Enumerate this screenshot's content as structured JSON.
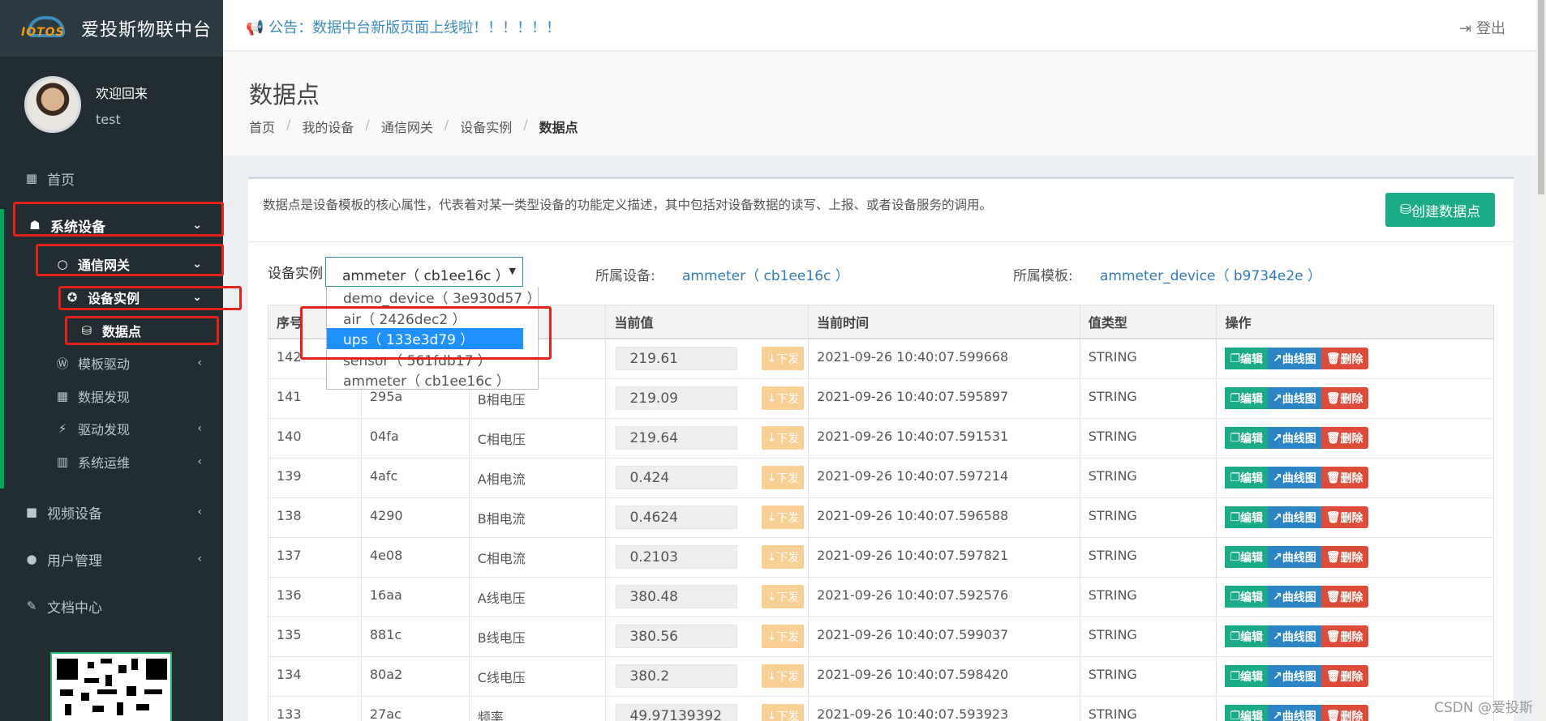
{
  "app": {
    "logo_text": "IOTOS",
    "title": "爱投斯物联中台"
  },
  "user": {
    "welcome": "欢迎回来",
    "name": "test"
  },
  "sidebar": {
    "items": [
      {
        "label": "首页",
        "icon": "dashboard-icon"
      },
      {
        "label": "系统设备",
        "icon": "sitemap-icon"
      },
      {
        "label": "通信网关",
        "icon": "circle-icon"
      },
      {
        "label": "设备实例",
        "icon": "rebel-icon"
      },
      {
        "label": "数据点",
        "icon": "database-icon"
      },
      {
        "label": "模板驱动",
        "icon": "wordpress-icon"
      },
      {
        "label": "数据发现",
        "icon": "table-icon"
      },
      {
        "label": "驱动发现",
        "icon": "plug-icon"
      },
      {
        "label": "系统运维",
        "icon": "bar-chart-icon"
      },
      {
        "label": "视频设备",
        "icon": "video-icon"
      },
      {
        "label": "用户管理",
        "icon": "user-icon"
      },
      {
        "label": "文档中心",
        "icon": "edit-icon"
      }
    ]
  },
  "topbar": {
    "notice": "公告：数据中台新版页面上线啦！！！！！！",
    "logout": "登出"
  },
  "page": {
    "title": "数据点",
    "breadcrumb": [
      "首页",
      "我的设备",
      "通信网关",
      "设备实例",
      "数据点"
    ],
    "description": "数据点是设备模板的核心属性，代表着对某一类型设备的功能定义描述，其中包括对设备数据的读写、上报、或者设备服务的调用。",
    "create_button": "创建数据点"
  },
  "filter": {
    "label": "设备实例",
    "selected": "ammeter（ cb1ee16c ）",
    "options": [
      "demo_device（ 3e930d57 ）",
      "air（ 2426dec2 ）",
      "ups（ 133e3d79 ）",
      "sensor（ 561fdb17 ）",
      "ammeter（ cb1ee16c ）"
    ],
    "highlighted_option": "ups（ 133e3d79 ）",
    "device_label": "所属设备:",
    "device_value": "ammeter（ cb1ee16c ）",
    "template_label": "所属模板:",
    "template_value": "ammeter_device（ b9734e2e ）"
  },
  "table": {
    "headers": [
      "序号",
      "",
      "",
      "当前值",
      "当前时间",
      "值类型",
      "操作"
    ],
    "send_label": "下发",
    "action_labels": {
      "edit": "编辑",
      "curve": "曲线图",
      "delete": "删除"
    },
    "rows": [
      {
        "no": "142",
        "id": "",
        "name": "",
        "value": "219.61",
        "time": "2021-09-26 10:40:07.599668",
        "type": "STRING"
      },
      {
        "no": "141",
        "id": "295a",
        "name": "B相电压",
        "value": "219.09",
        "time": "2021-09-26 10:40:07.595897",
        "type": "STRING"
      },
      {
        "no": "140",
        "id": "04fa",
        "name": "C相电压",
        "value": "219.64",
        "time": "2021-09-26 10:40:07.591531",
        "type": "STRING"
      },
      {
        "no": "139",
        "id": "4afc",
        "name": "A相电流",
        "value": "0.424",
        "time": "2021-09-26 10:40:07.597214",
        "type": "STRING"
      },
      {
        "no": "138",
        "id": "4290",
        "name": "B相电流",
        "value": "0.4624",
        "time": "2021-09-26 10:40:07.596588",
        "type": "STRING"
      },
      {
        "no": "137",
        "id": "4e08",
        "name": "C相电流",
        "value": "0.2103",
        "time": "2021-09-26 10:40:07.597821",
        "type": "STRING"
      },
      {
        "no": "136",
        "id": "16aa",
        "name": "A线电压",
        "value": "380.48",
        "time": "2021-09-26 10:40:07.592576",
        "type": "STRING"
      },
      {
        "no": "135",
        "id": "881c",
        "name": "B线电压",
        "value": "380.56",
        "time": "2021-09-26 10:40:07.599037",
        "type": "STRING"
      },
      {
        "no": "134",
        "id": "80a2",
        "name": "C线电压",
        "value": "380.2",
        "time": "2021-09-26 10:40:07.598420",
        "type": "STRING"
      },
      {
        "no": "133",
        "id": "27ac",
        "name": "频率",
        "value": "49.97139392",
        "time": "2021-09-26 10:40:07.593923",
        "type": "STRING"
      }
    ]
  },
  "watermark": "CSDN @爱投斯"
}
